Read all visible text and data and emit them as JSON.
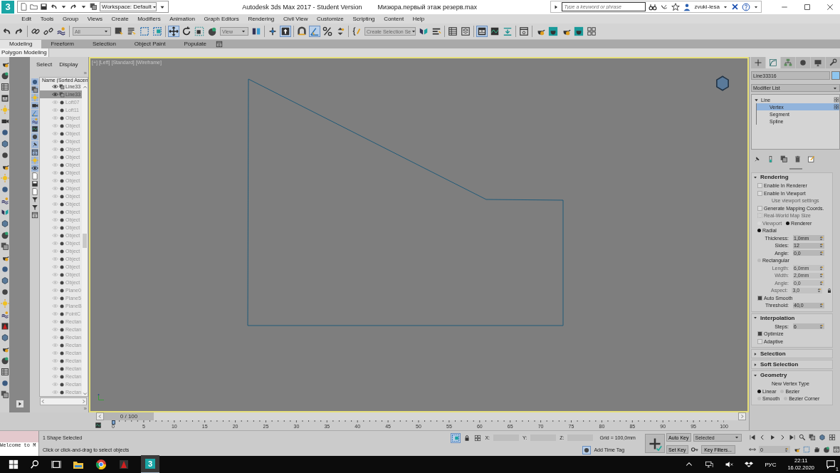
{
  "title_bar": {
    "logo_text": "3",
    "workspace": "Workspace: Default",
    "app_title": "Autodesk 3ds Max 2017 - Student Version",
    "file_name": "Мизюра.первый этаж резерв.max",
    "search": {
      "placeholder": "Type a keyword or phrase"
    },
    "user": "zvuki-lesa"
  },
  "menu": [
    "Edit",
    "Tools",
    "Group",
    "Views",
    "Create",
    "Modifiers",
    "Animation",
    "Graph Editors",
    "Rendering",
    "Civil View",
    "Customize",
    "Scripting",
    "Content",
    "Help"
  ],
  "toolbar": {
    "selection_filter": "All",
    "reference_coord": "View",
    "named_selection": "Create Selection Se"
  },
  "ribbon": {
    "tabs": [
      {
        "label": "Modeling",
        "selected": true
      },
      {
        "label": "Freeform",
        "selected": false
      },
      {
        "label": "Selection",
        "selected": false
      },
      {
        "label": "Object Paint",
        "selected": false
      },
      {
        "label": "Populate",
        "selected": false
      }
    ],
    "panel": "Polygon Modeling"
  },
  "scene_explorer": {
    "tabs": [
      "Select",
      "Display"
    ],
    "more": "»",
    "column": "Name (Sorted Ascen",
    "footer_more": "»",
    "rows": [
      {
        "name": "Line33",
        "visible": true,
        "selected": false
      },
      {
        "name": "Line33",
        "visible": true,
        "selected": true
      },
      {
        "name": "Loft07",
        "visible": false,
        "selected": false
      },
      {
        "name": "Loft11",
        "visible": false,
        "selected": false
      },
      {
        "name": "Object",
        "visible": false,
        "selected": false
      },
      {
        "name": "Object",
        "visible": false,
        "selected": false
      },
      {
        "name": "Object",
        "visible": false,
        "selected": false
      },
      {
        "name": "Object",
        "visible": false,
        "selected": false
      },
      {
        "name": "Object",
        "visible": false,
        "selected": false
      },
      {
        "name": "Object",
        "visible": false,
        "selected": false
      },
      {
        "name": "Object",
        "visible": false,
        "selected": false
      },
      {
        "name": "Object",
        "visible": false,
        "selected": false
      },
      {
        "name": "Object",
        "visible": false,
        "selected": false
      },
      {
        "name": "Object",
        "visible": false,
        "selected": false
      },
      {
        "name": "Object",
        "visible": false,
        "selected": false
      },
      {
        "name": "Object",
        "visible": false,
        "selected": false
      },
      {
        "name": "Object",
        "visible": false,
        "selected": false
      },
      {
        "name": "Object",
        "visible": false,
        "selected": false
      },
      {
        "name": "Object",
        "visible": false,
        "selected": false
      },
      {
        "name": "Object",
        "visible": false,
        "selected": false
      },
      {
        "name": "Object",
        "visible": false,
        "selected": false
      },
      {
        "name": "Object",
        "visible": false,
        "selected": false
      },
      {
        "name": "Object",
        "visible": false,
        "selected": false
      },
      {
        "name": "Object",
        "visible": false,
        "selected": false
      },
      {
        "name": "Object",
        "visible": false,
        "selected": false
      },
      {
        "name": "Object",
        "visible": false,
        "selected": false
      },
      {
        "name": "Plane0",
        "visible": false,
        "selected": false
      },
      {
        "name": "Plane5",
        "visible": false,
        "selected": false
      },
      {
        "name": "PlaneB",
        "visible": false,
        "selected": false
      },
      {
        "name": "PointC",
        "visible": false,
        "selected": false
      },
      {
        "name": "Rectan",
        "visible": false,
        "selected": false
      },
      {
        "name": "Rectan",
        "visible": false,
        "selected": false
      },
      {
        "name": "Rectan",
        "visible": false,
        "selected": false
      },
      {
        "name": "Rectan",
        "visible": false,
        "selected": false
      },
      {
        "name": "Rectan",
        "visible": false,
        "selected": false
      },
      {
        "name": "Rectan",
        "visible": false,
        "selected": false
      },
      {
        "name": "Rectan",
        "visible": false,
        "selected": false
      },
      {
        "name": "Rectan",
        "visible": false,
        "selected": false
      },
      {
        "name": "Rectan",
        "visible": false,
        "selected": false
      },
      {
        "name": "Rectan",
        "visible": false,
        "selected": false
      }
    ]
  },
  "viewport": {
    "label": "[+] [Left] [Standard] [Wireframe]"
  },
  "command_panel": {
    "tabs": [
      {
        "kind": "create",
        "selected": false
      },
      {
        "kind": "modify",
        "selected": true
      },
      {
        "kind": "hierarchy",
        "selected": false
      },
      {
        "kind": "motion",
        "selected": false
      },
      {
        "kind": "display",
        "selected": false
      },
      {
        "kind": "utilities",
        "selected": false
      }
    ],
    "object_name": "Line33316",
    "modifier_list": "Modifier List",
    "stack": [
      {
        "label": "Line",
        "expanded": true,
        "selected": false,
        "children": [
          {
            "label": "Vertex",
            "selected": true
          },
          {
            "label": "Segment",
            "selected": false
          },
          {
            "label": "Spline",
            "selected": false
          }
        ]
      }
    ],
    "rollouts": [
      {
        "title": "Rendering",
        "expanded": true,
        "controls": [
          {
            "kind": "check",
            "label": "Enable In Renderer",
            "checked": false,
            "disabled": false
          },
          {
            "kind": "check",
            "label": "Enable In Viewport",
            "checked": false,
            "disabled": false
          },
          {
            "kind": "note",
            "label": "Use viewport settings",
            "disabled": true
          },
          {
            "kind": "check",
            "label": "Generate Mapping Coords.",
            "checked": false,
            "disabled": false
          },
          {
            "kind": "check",
            "label": "Real-World Map Size",
            "checked": false,
            "disabled": true
          },
          {
            "kind": "radios",
            "items": [
              {
                "label": "Viewport",
                "selected": false,
                "disabled": true
              },
              {
                "label": "Renderer",
                "selected": true,
                "disabled": false
              }
            ]
          },
          {
            "kind": "radios",
            "items": [
              {
                "label": "Radial",
                "selected": true,
                "disabled": false
              }
            ]
          },
          {
            "kind": "spinner",
            "label": "Thickness:",
            "value": "1,0mm",
            "disabled": false
          },
          {
            "kind": "spinner",
            "label": "Sides:",
            "value": "12",
            "disabled": false
          },
          {
            "kind": "spinner",
            "label": "Angle:",
            "value": "0,0",
            "disabled": false
          },
          {
            "kind": "radios",
            "items": [
              {
                "label": "Rectangular",
                "selected": false,
                "disabled": false
              }
            ]
          },
          {
            "kind": "spinner",
            "label": "Length:",
            "value": "6,0mm",
            "disabled": true
          },
          {
            "kind": "spinner",
            "label": "Width:",
            "value": "2,0mm",
            "disabled": true
          },
          {
            "kind": "spinner",
            "label": "Angle:",
            "value": "0,0",
            "disabled": true
          },
          {
            "kind": "spinner-lock",
            "label": "Aspect:",
            "value": "3,0",
            "disabled": true
          },
          {
            "kind": "check",
            "label": "Auto Smooth",
            "checked": true,
            "disabled": false
          },
          {
            "kind": "spinner",
            "label": "Threshold:",
            "value": "40,0",
            "disabled": false
          }
        ]
      },
      {
        "title": "Interpolation",
        "expanded": true,
        "controls": [
          {
            "kind": "spinner",
            "label": "Steps:",
            "value": "6",
            "disabled": false
          },
          {
            "kind": "check",
            "label": "Optimize",
            "checked": true,
            "disabled": false
          },
          {
            "kind": "check",
            "label": "Adaptive",
            "checked": false,
            "disabled": false
          }
        ]
      },
      {
        "title": "Selection",
        "expanded": false
      },
      {
        "title": "Soft Selection",
        "expanded": false
      },
      {
        "title": "Geometry",
        "expanded": true,
        "controls": [
          {
            "kind": "note",
            "label": "New Vertex Type",
            "disabled": false
          },
          {
            "kind": "radios",
            "items": [
              {
                "label": "Linear",
                "selected": true,
                "disabled": false
              },
              {
                "label": "Bezier",
                "selected": false,
                "disabled": false
              }
            ]
          },
          {
            "kind": "radios",
            "items": [
              {
                "label": "Smooth",
                "selected": false,
                "disabled": false
              },
              {
                "label": "Bezier Corner",
                "selected": false,
                "disabled": false
              }
            ]
          }
        ]
      }
    ]
  },
  "timeline": {
    "position": "0 / 100",
    "level": 0,
    "ticks": [
      "0",
      "5",
      "10",
      "15",
      "20",
      "25",
      "30",
      "35",
      "40",
      "45",
      "50",
      "55",
      "60",
      "65",
      "70",
      "75",
      "80",
      "85",
      "90",
      "95",
      "100"
    ]
  },
  "status": {
    "listener": "Welcome to M",
    "selection": "1 Shape Selected",
    "prompt": "Click or click-and-drag to select objects",
    "x_label": "X:",
    "y_label": "Y:",
    "z_label": "Z:",
    "grid": "Grid = 100,0mm",
    "time_tag": "Add Time Tag",
    "auto_key": "Auto Key",
    "key_mode": "Selected",
    "set_key": "Set Key",
    "key_filters": "Key Filters...",
    "frame": "0"
  },
  "taskbar": {
    "app_text": "3",
    "language": "РУС",
    "time": "22:11",
    "date": "16.02.2020",
    "notifications": "1"
  }
}
